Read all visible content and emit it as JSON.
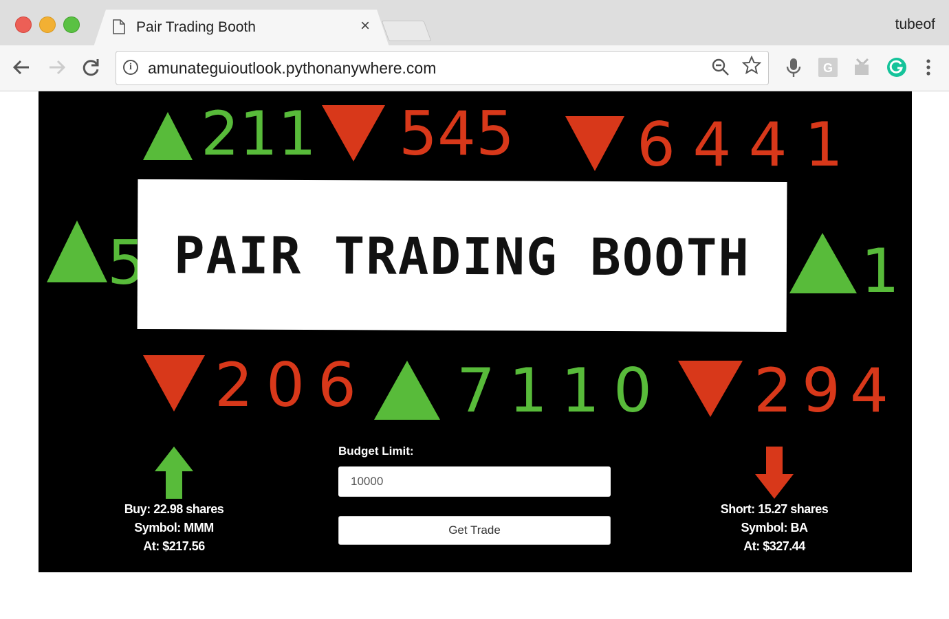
{
  "browser": {
    "tab_title": "Pair Trading Booth",
    "tab_close": "×",
    "profile_name": "tubeof",
    "url": "amunateguioutlook.pythonanywhere.com"
  },
  "page": {
    "title": "PAIR TRADING BOOTH",
    "ticker": {
      "top": [
        {
          "direction": "up",
          "value": "211"
        },
        {
          "direction": "down",
          "value": "545"
        },
        {
          "direction": "down",
          "value": "6441"
        }
      ],
      "middle": [
        {
          "direction": "up",
          "value": "5"
        },
        {
          "direction": "up",
          "value": "1"
        }
      ],
      "bottom": [
        {
          "direction": "down",
          "value": "206"
        },
        {
          "direction": "up",
          "value": "7110"
        },
        {
          "direction": "down",
          "value": "294"
        }
      ]
    },
    "buy": {
      "shares_label": "Buy:",
      "shares": "22.98",
      "shares_unit": "shares",
      "symbol_label": "Symbol:",
      "symbol": "MMM",
      "price_label": "At:",
      "price": "$217.56"
    },
    "short": {
      "shares_label": "Short:",
      "shares": "15.27",
      "shares_unit": "shares",
      "symbol_label": "Symbol:",
      "symbol": "BA",
      "price_label": "At:",
      "price": "$327.44"
    },
    "form": {
      "budget_label": "Budget Limit:",
      "budget_value": "10000",
      "button_label": "Get Trade"
    },
    "colors": {
      "up": "#58bb3a",
      "down": "#d8381a",
      "background": "#000000"
    }
  }
}
